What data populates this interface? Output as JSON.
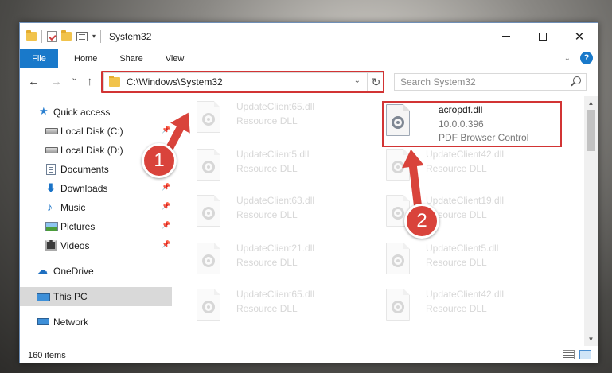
{
  "window": {
    "title": "System32",
    "caption": {
      "close_glyph": "✕"
    }
  },
  "ribbon": {
    "tabs": [
      {
        "label": "File"
      },
      {
        "label": "Home"
      },
      {
        "label": "Share"
      },
      {
        "label": "View"
      }
    ],
    "help_glyph": "?"
  },
  "nav": {
    "back_glyph": "←",
    "forward_glyph": "→",
    "recent_glyph": "⌄",
    "up_glyph": "↑",
    "address": "C:\\Windows\\System32",
    "refresh_glyph": "↻",
    "search_placeholder": "Search System32"
  },
  "sidebar": {
    "items": [
      {
        "label": "Quick access",
        "icon": "star-icon"
      },
      {
        "label": "Local Disk (C:)",
        "icon": "drive-icon",
        "pinned": true
      },
      {
        "label": "Local Disk (D:)",
        "icon": "drive-icon",
        "pinned": false
      },
      {
        "label": "Documents",
        "icon": "documents-icon",
        "pinned": true
      },
      {
        "label": "Downloads",
        "icon": "downloads-icon",
        "pinned": true
      },
      {
        "label": "Music",
        "icon": "music-icon",
        "pinned": true
      },
      {
        "label": "Pictures",
        "icon": "pictures-icon",
        "pinned": true
      },
      {
        "label": "Videos",
        "icon": "videos-icon",
        "pinned": true
      },
      {
        "label": "OneDrive",
        "icon": "onedrive-icon"
      },
      {
        "label": "This PC",
        "icon": "this-pc-icon",
        "selected": true
      },
      {
        "label": "Network",
        "icon": "network-icon"
      }
    ]
  },
  "files": {
    "left_column": [
      {
        "name": "UpdateClient65.dll",
        "type": "Resource DLL"
      },
      {
        "name": "UpdateClient5.dll",
        "type": "Resource DLL"
      },
      {
        "name": "UpdateClient63.dll",
        "type": "Resource DLL"
      },
      {
        "name": "UpdateClient21.dll",
        "type": "Resource DLL"
      },
      {
        "name": "UpdateClient65.dll",
        "type": "Resource DLL"
      }
    ],
    "right_column": [
      {
        "name": "acropdf.dll",
        "version": "10.0.0.396",
        "type": "PDF Browser Control"
      },
      {
        "name": "UpdateClient42.dll",
        "type": "Resource DLL"
      },
      {
        "name": "UpdateClient19.dll",
        "type": "Resource DLL"
      },
      {
        "name": "UpdateClient5.dll",
        "type": "Resource DLL"
      },
      {
        "name": "UpdateClient42.dll",
        "type": "Resource DLL"
      }
    ]
  },
  "status": {
    "item_count": "160 items"
  },
  "callouts": [
    {
      "number": "1"
    },
    {
      "number": "2"
    }
  ],
  "colors": {
    "accent": "#1979ca",
    "highlight": "#d23434",
    "callout": "#d9433b"
  }
}
